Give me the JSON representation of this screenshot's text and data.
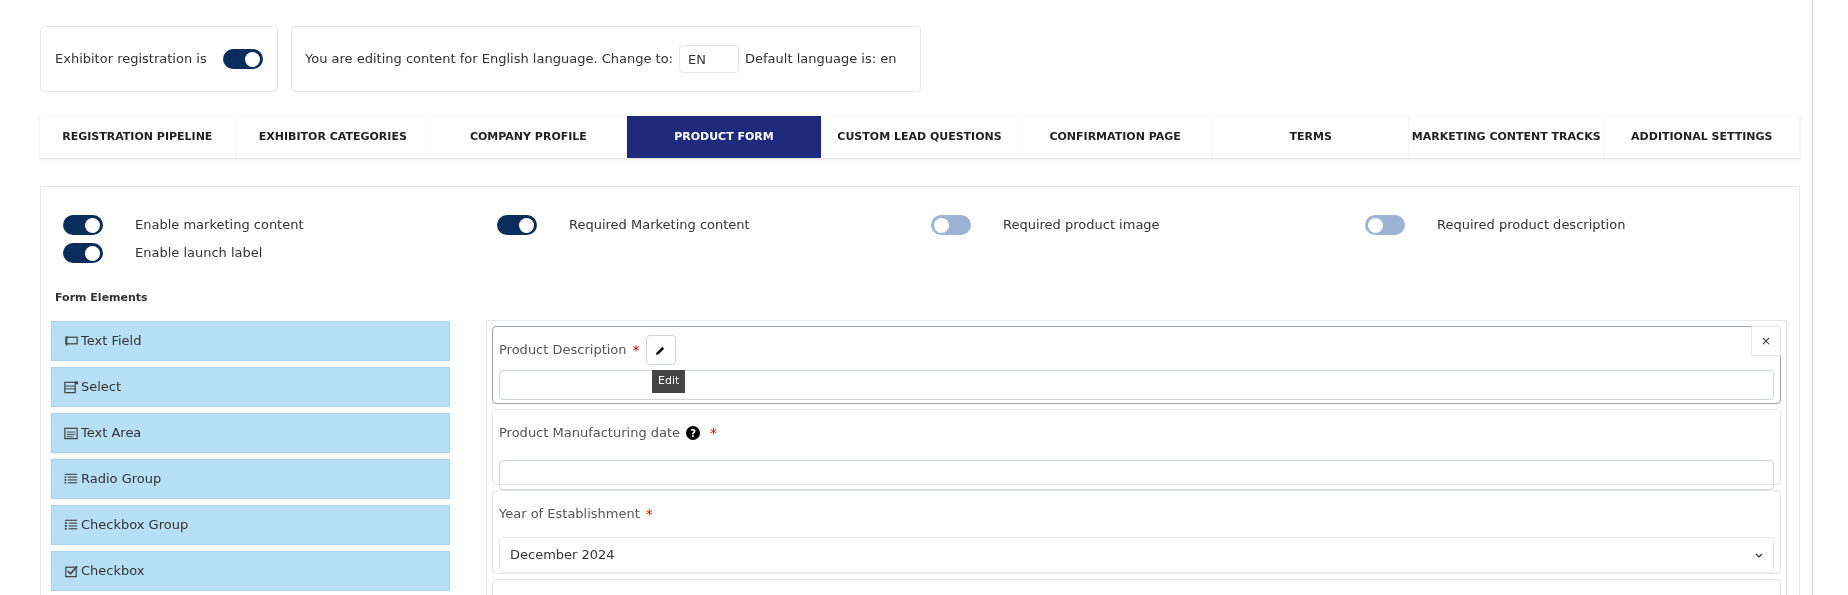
{
  "registration": {
    "label": "Exhibitor registration is",
    "on": true
  },
  "language": {
    "before": "You are editing content for English language. Change to:",
    "value": "EN",
    "after": "Default language is: en"
  },
  "tabs": [
    {
      "label": "REGISTRATION PIPELINE",
      "selected": false
    },
    {
      "label": "EXHIBITOR CATEGORIES",
      "selected": false
    },
    {
      "label": "COMPANY PROFILE",
      "selected": false
    },
    {
      "label": "PRODUCT FORM",
      "selected": true
    },
    {
      "label": "CUSTOM LEAD QUESTIONS",
      "selected": false
    },
    {
      "label": "CONFIRMATION PAGE",
      "selected": false
    },
    {
      "label": "TERMS",
      "selected": false
    },
    {
      "label": "MARKETING CONTENT TRACKS",
      "selected": false
    },
    {
      "label": "ADDITIONAL SETTINGS",
      "selected": false
    }
  ],
  "settings": [
    [
      {
        "label": "Enable marketing content",
        "on": true
      },
      {
        "label": "Enable launch label",
        "on": true
      }
    ],
    [
      {
        "label": "Required Marketing content",
        "on": true
      }
    ],
    [
      {
        "label": "Required product image",
        "on": false
      }
    ],
    [
      {
        "label": "Required product description",
        "on": false
      }
    ]
  ],
  "form_elements": {
    "title": "Form Elements",
    "items": [
      {
        "label": "Text Field",
        "kind": "text"
      },
      {
        "label": "Select",
        "kind": "select"
      },
      {
        "label": "Text Area",
        "kind": "textarea"
      },
      {
        "label": "Radio Group",
        "kind": "radio"
      },
      {
        "label": "Checkbox Group",
        "kind": "checkgroup"
      },
      {
        "label": "Checkbox",
        "kind": "checkbox"
      }
    ]
  },
  "fields": [
    {
      "kind": "text",
      "label": "Product Description",
      "required_mark": "*",
      "editing": true,
      "tooltip": "Edit",
      "close": "×"
    },
    {
      "kind": "text",
      "label": "Product Manufacturing date",
      "required_mark": "*",
      "help": "?"
    },
    {
      "kind": "select",
      "label": "Year of Establishment",
      "required_mark": "*",
      "value": "December 2024"
    }
  ]
}
